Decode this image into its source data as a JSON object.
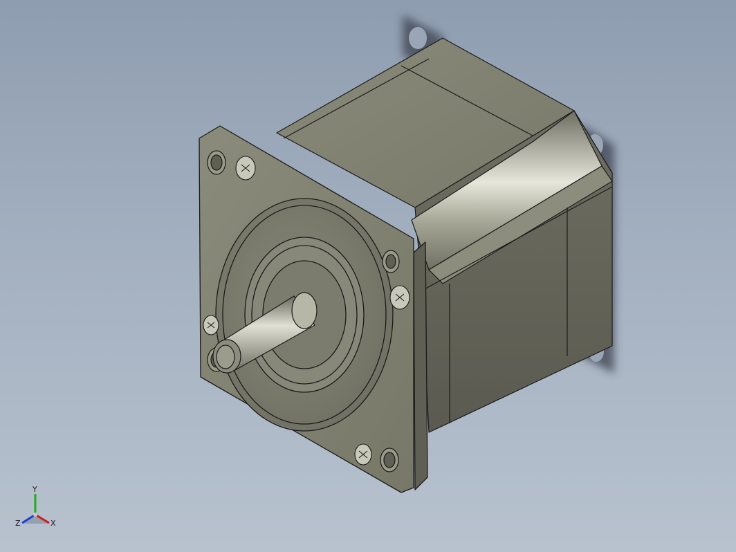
{
  "viewport": {
    "background_top": "#8e9db0",
    "background_bottom": "#b8c2cf"
  },
  "model": {
    "body_color": "#80806f",
    "body_light": "#a9a996",
    "body_dark": "#5e5e53",
    "edge_color": "#1a1a1a",
    "shadow_color": "#3c4350"
  },
  "triad": {
    "x_label": "X",
    "y_label": "Y",
    "z_label": "Z",
    "x_color": "#d11a1a",
    "y_color": "#1fae1f",
    "z_color": "#1f3fd1"
  }
}
